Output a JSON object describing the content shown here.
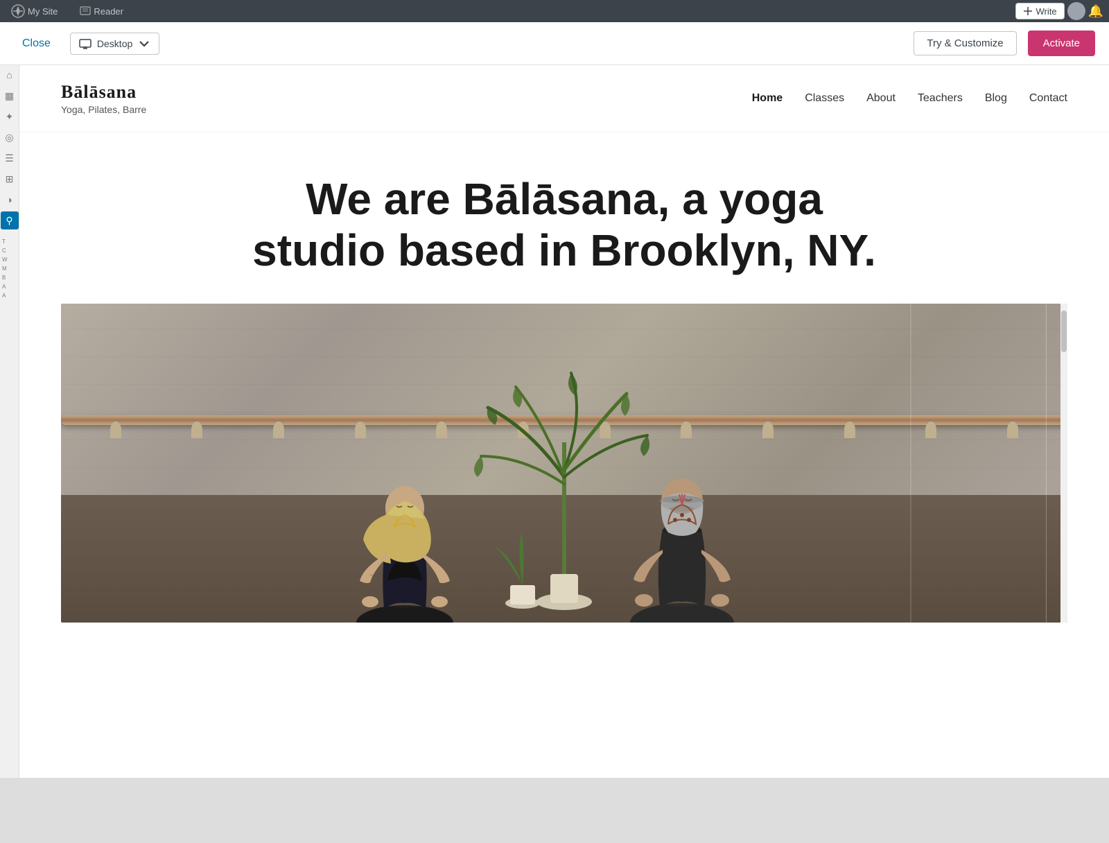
{
  "admin_bar": {
    "my_site_label": "My Site",
    "reader_label": "Reader",
    "write_label": "Write"
  },
  "preview_bar": {
    "close_label": "Close",
    "device_label": "Desktop",
    "try_customize_label": "Try & Customize",
    "activate_label": "Activate"
  },
  "site": {
    "title": "Bālāsana",
    "tagline": "Yoga, Pilates, Barre",
    "nav_items": [
      {
        "label": "Home",
        "active": true
      },
      {
        "label": "Classes",
        "active": false
      },
      {
        "label": "About",
        "active": false
      },
      {
        "label": "Teachers",
        "active": false
      },
      {
        "label": "Blog",
        "active": false
      },
      {
        "label": "Contact",
        "active": false
      }
    ],
    "hero_title": "We are Bālāsana, a yoga studio based in Brooklyn, NY."
  },
  "sidebar": {
    "icons": [
      {
        "name": "home-icon",
        "symbol": "⌂"
      },
      {
        "name": "stats-icon",
        "symbol": "▦"
      },
      {
        "name": "tools-icon",
        "symbol": "✦"
      },
      {
        "name": "users-icon",
        "symbol": "◎"
      },
      {
        "name": "comments-icon",
        "symbol": "☰"
      },
      {
        "name": "pages-icon",
        "symbol": "⊞"
      },
      {
        "name": "time-icon",
        "symbol": "◑"
      },
      {
        "name": "search-icon",
        "symbol": "⚲"
      }
    ],
    "text_items": [
      "T",
      "C",
      "W",
      "M",
      "B",
      "A",
      "A"
    ]
  },
  "colors": {
    "activate_btn": "#c9356e",
    "admin_bar_bg": "#3c434a",
    "nav_active": "#1a1a1a",
    "hero_title": "#1a1a1a"
  }
}
